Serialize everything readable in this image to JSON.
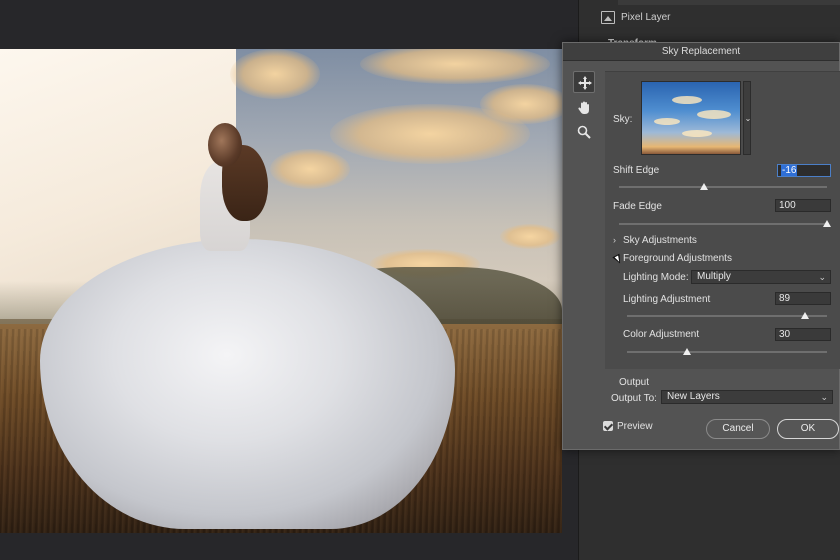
{
  "properties_panel": {
    "layer_type_label": "Pixel Layer",
    "section_label": "Transform"
  },
  "dialog": {
    "title": "Sky Replacement",
    "tools": [
      {
        "name": "move-tool",
        "icon": "move-icon",
        "active": true
      },
      {
        "name": "hand-tool",
        "icon": "hand-icon",
        "active": false
      },
      {
        "name": "zoom-tool",
        "icon": "zoom-icon",
        "active": false
      }
    ],
    "sky": {
      "label": "Sky:",
      "dropdown_icon": "chevron-down-icon"
    },
    "shift_edge": {
      "label": "Shift Edge",
      "value": "-16",
      "slider_level": 0.41,
      "range": [
        -100,
        100
      ]
    },
    "fade_edge": {
      "label": "Fade Edge",
      "value": "100",
      "slider_level": 1.0,
      "range": [
        0,
        100
      ]
    },
    "sky_adjustments": {
      "label": "Sky Adjustments",
      "expanded": false
    },
    "foreground_adjustments": {
      "label": "Foreground Adjustments",
      "expanded": true,
      "lighting_mode": {
        "label": "Lighting Mode:",
        "value": "Multiply"
      },
      "lighting_adjustment": {
        "label": "Lighting Adjustment",
        "value": "89",
        "slider_level": 0.89,
        "range": [
          0,
          100
        ]
      },
      "color_adjustment": {
        "label": "Color Adjustment",
        "value": "30",
        "slider_level": 0.3,
        "range": [
          0,
          100
        ]
      }
    },
    "output": {
      "label": "Output",
      "output_to_label": "Output To:",
      "output_to_value": "New Layers"
    },
    "preview": {
      "label": "Preview",
      "checked": true
    },
    "buttons": {
      "cancel": "Cancel",
      "ok": "OK"
    }
  },
  "colors": {
    "dialog_bg": "#535353",
    "titlebar_bg": "#3f3f3f",
    "field_bg": "#3a3a3a",
    "selection_blue": "#2f6fd6",
    "canvas_bg": "#27272a"
  }
}
